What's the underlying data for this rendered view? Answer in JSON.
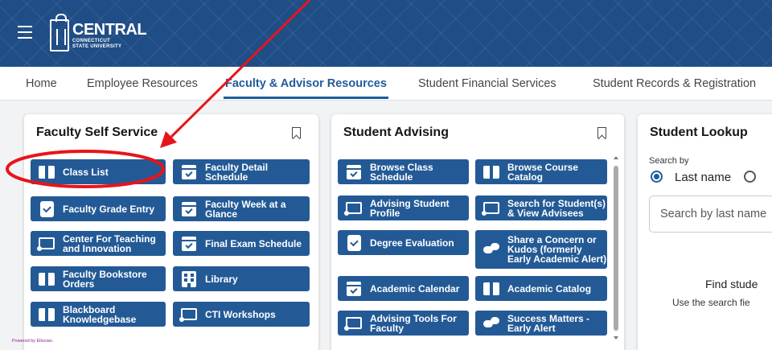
{
  "header": {
    "menu_icon": "hamburger-menu-icon",
    "logo": {
      "name": "CENTRAL",
      "line2": "CONNECTICUT",
      "line3": "STATE UNIVERSITY"
    }
  },
  "nav": {
    "tabs": [
      {
        "label": "Home",
        "active": false
      },
      {
        "label": "Employee Resources",
        "active": false
      },
      {
        "label": "Faculty & Advisor Resources",
        "active": true
      },
      {
        "label": "Student Financial Services",
        "active": false
      },
      {
        "label": "Student Records & Registration",
        "active": false
      }
    ]
  },
  "faculty_card": {
    "title": "Faculty Self Service",
    "buttons": [
      {
        "label": "Class List",
        "icon": "book-icon"
      },
      {
        "label": "Faculty Detail Schedule",
        "icon": "calendar-icon"
      },
      {
        "label": "Faculty Grade Entry",
        "icon": "clipboard-check-icon"
      },
      {
        "label": "Faculty Week at a Glance",
        "icon": "calendar-icon"
      },
      {
        "label": "Center For Teaching and Innovation",
        "icon": "presentation-icon"
      },
      {
        "label": "Final Exam Schedule",
        "icon": "calendar-icon"
      },
      {
        "label": "Faculty Bookstore Orders",
        "icon": "book-icon"
      },
      {
        "label": "Library",
        "icon": "building-icon"
      },
      {
        "label": "Blackboard Knowledgebase",
        "icon": "book-icon"
      },
      {
        "label": "CTI Workshops",
        "icon": "presentation-icon"
      }
    ],
    "powered_by": "Powered by Ellucian."
  },
  "advising_card": {
    "title": "Student Advising",
    "buttons": [
      {
        "label": "Browse Class Schedule",
        "icon": "calendar-icon"
      },
      {
        "label": "Browse Course Catalog",
        "icon": "book-icon"
      },
      {
        "label": "Advising Student Profile",
        "icon": "presentation-icon"
      },
      {
        "label": "Search for Student(s) & View Advisees",
        "icon": "presentation-icon"
      },
      {
        "label": "Degree Evaluation",
        "icon": "clipboard-check-icon"
      },
      {
        "label": "Share a Concern or Kudos (formerly Early Academic Alert)",
        "icon": "chat-icon"
      },
      {
        "label": "Academic Calendar",
        "icon": "calendar-icon"
      },
      {
        "label": "Academic Catalog",
        "icon": "book-icon"
      },
      {
        "label": "Advising Tools For Faculty",
        "icon": "presentation-icon"
      },
      {
        "label": "Success Matters - Early Alert",
        "icon": "chat-icon"
      }
    ]
  },
  "lookup_card": {
    "title": "Student Lookup",
    "search_by": "Search by",
    "radio_last_name": "Last name",
    "search_placeholder": "Search by last name",
    "find_title": "Find stude",
    "find_sub": "Use the search fie"
  },
  "colors": {
    "brand": "#1f4d85",
    "button": "#235a96",
    "accent": "#1f5c9c",
    "annotation": "#e8141b"
  }
}
